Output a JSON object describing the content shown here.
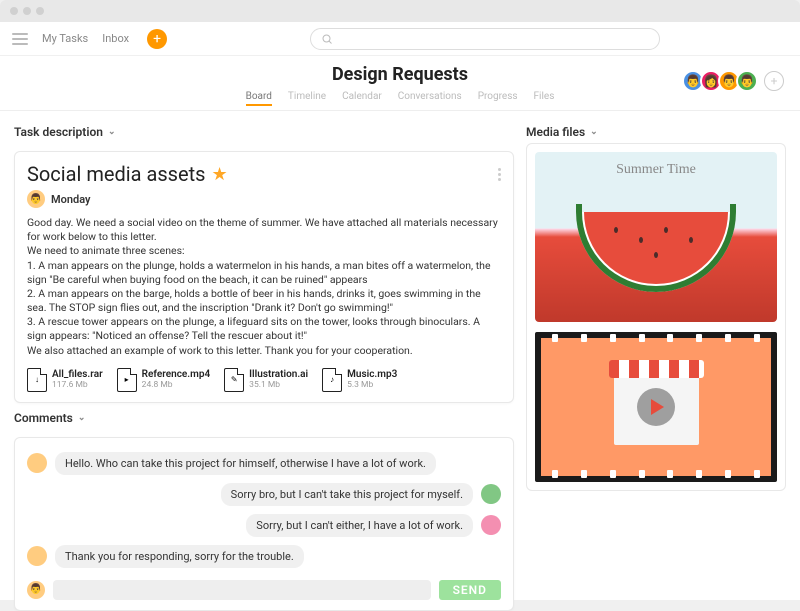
{
  "nav": {
    "my_tasks": "My Tasks",
    "inbox": "Inbox"
  },
  "page_title": "Design Requests",
  "tabs": [
    "Board",
    "Timeline",
    "Calendar",
    "Conversations",
    "Progress",
    "Files"
  ],
  "section": {
    "task_desc": "Task description",
    "comments": "Comments",
    "media": "Media files"
  },
  "task": {
    "title": "Social media assets",
    "day": "Monday",
    "body": "Good day. We need a social video on the theme of summer. We have attached all materials necessary for work below to this letter.\nWe need to animate three scenes:\n1. A man appears on the plunge, holds a watermelon in his hands, a man bites off a watermelon, the sign \"Be careful when buying food on the beach, it can be ruined\" appears\n2. A man appears on the barge, holds a bottle of beer in his hands, drinks it, goes swimming in the sea. The STOP sign flies out, and the inscription \"Drank it? Don't go swimming!\"\n3. A rescue tower appears on the plunge, a lifeguard sits on the tower, looks through binoculars. A sign appears: \"Noticed an offense? Tell the rescuer about it!\"\nWe also attached an example of work to this letter. Thank you for your cooperation."
  },
  "files": [
    {
      "name": "All_files.rar",
      "size": "117.6 Mb",
      "glyph": "↓"
    },
    {
      "name": "Reference.mp4",
      "size": "24.8 Mb",
      "glyph": "▸"
    },
    {
      "name": "Illustration.ai",
      "size": "35.1 Mb",
      "glyph": "✎"
    },
    {
      "name": "Music.mp3",
      "size": "5.3 Mb",
      "glyph": "♪"
    }
  ],
  "comments": [
    {
      "side": "left",
      "av": "c1",
      "text": "Hello. Who can take this project for himself, otherwise I have a lot of work."
    },
    {
      "side": "right",
      "av": "c2",
      "text": "Sorry bro, but I can't take this project for myself."
    },
    {
      "side": "right",
      "av": "c3",
      "text": "Sorry, but I can't either, I have a lot of work."
    },
    {
      "side": "left",
      "av": "c1",
      "text": "Thank you for responding, sorry for the trouble."
    }
  ],
  "send": "SEND",
  "media_caption": "Summer Time"
}
